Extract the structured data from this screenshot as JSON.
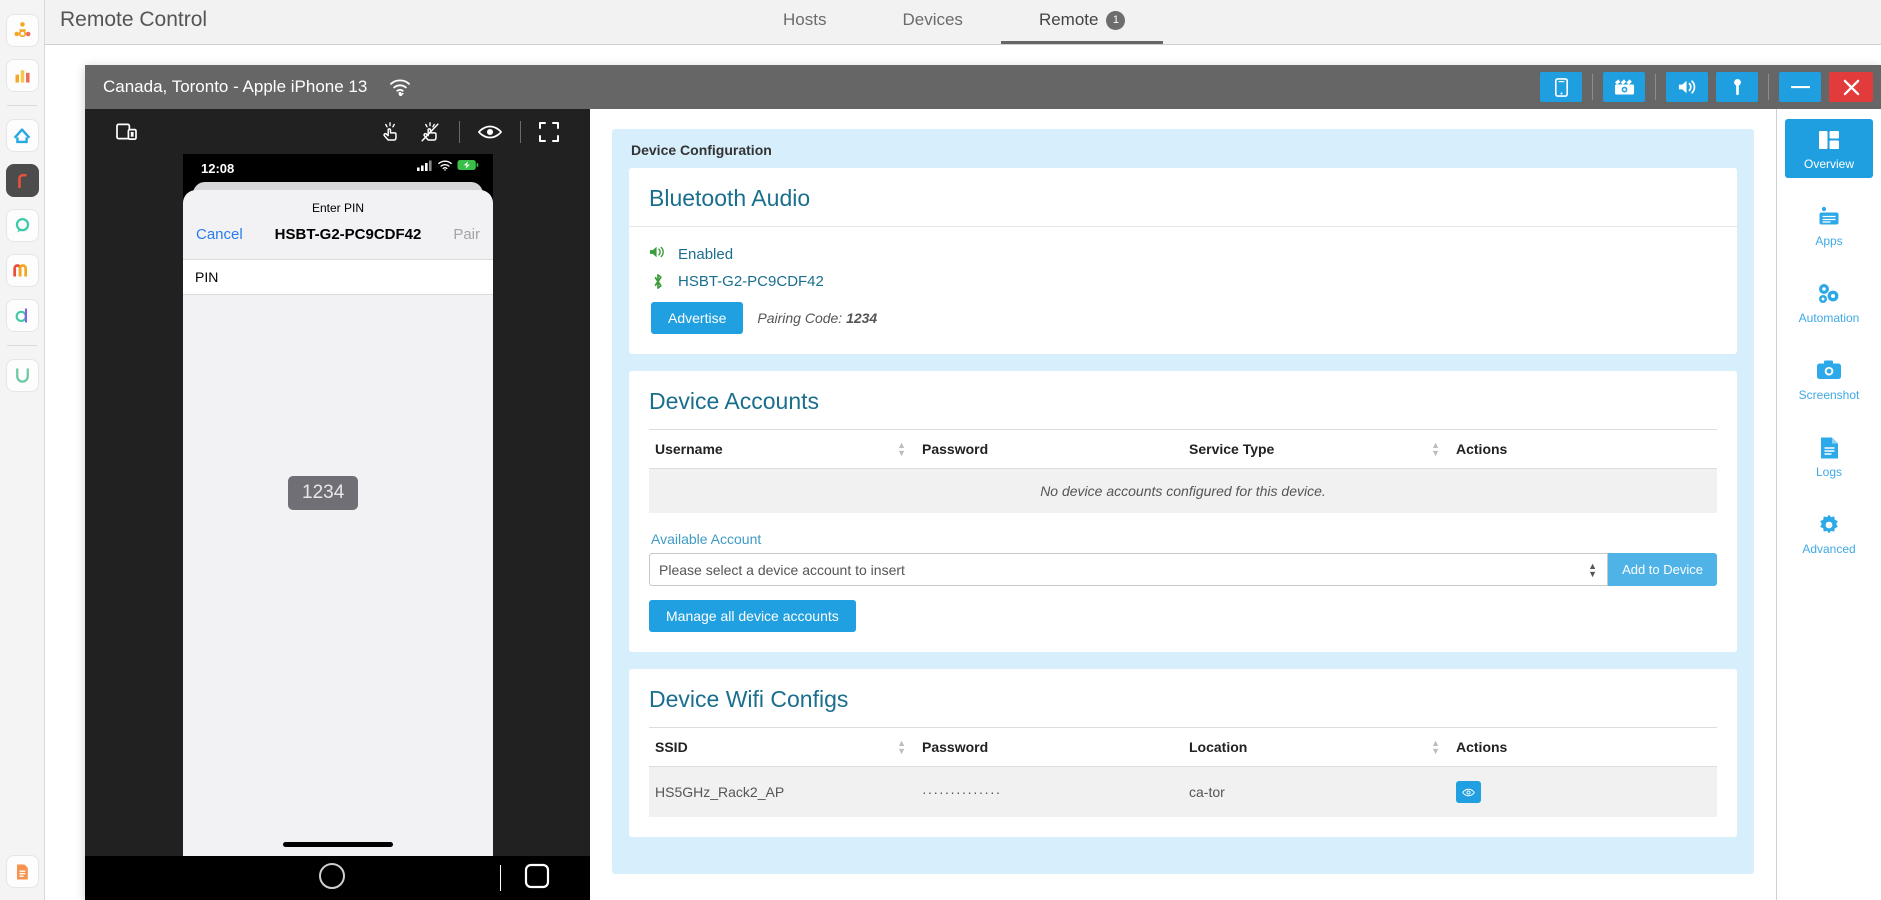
{
  "app_rail": {
    "items": [
      {
        "name": "team-app-icon",
        "glyph": "⚙"
      },
      {
        "name": "analytics-app-icon",
        "glyph": "ὌA"
      },
      {
        "name": "home-app-icon",
        "glyph": "⌂"
      },
      {
        "name": "r-app-icon",
        "glyph": "r"
      },
      {
        "name": "p-app-icon",
        "glyph": "p"
      },
      {
        "name": "m-app-icon",
        "glyph": "m"
      },
      {
        "name": "d-app-icon",
        "glyph": "d"
      },
      {
        "name": "u-app-icon",
        "glyph": "U"
      },
      {
        "name": "document-app-icon",
        "glyph": "☰"
      }
    ]
  },
  "topbar": {
    "title": "Remote Control",
    "tabs": [
      {
        "label": "Hosts",
        "active": false,
        "badge": ""
      },
      {
        "label": "Devices",
        "active": false,
        "badge": ""
      },
      {
        "label": "Remote",
        "active": true,
        "badge": "1"
      }
    ]
  },
  "window": {
    "device_name": "Canada, Toronto - Apple iPhone 13",
    "wifi_icon": "wifi-check-icon",
    "title_buttons": [
      {
        "name": "phone-view-button",
        "icon": "phone-icon"
      },
      {
        "name": "video-record-button",
        "icon": "clapperboard-camera-icon"
      },
      {
        "name": "speaker-button",
        "icon": "speaker-icon"
      },
      {
        "name": "microphone-button",
        "icon": "microphone-icon"
      },
      {
        "name": "minimize-button",
        "icon": "minus-icon"
      },
      {
        "name": "close-button",
        "icon": "close-x-icon"
      }
    ]
  },
  "phone_toolbar": {
    "buttons": [
      {
        "name": "device-screen-toggle-icon",
        "icon": "device-screen-icon"
      },
      {
        "name": "touch-enable-icon",
        "icon": "tap-hand-icon"
      },
      {
        "name": "touch-disable-icon",
        "icon": "tap-hand-disabled-icon"
      },
      {
        "name": "watch-mode-icon",
        "icon": "eye-icon"
      },
      {
        "name": "fullscreen-icon",
        "icon": "expand-icon"
      }
    ]
  },
  "phone": {
    "status_time": "12:08",
    "status_icons": [
      "cellular-signal-icon",
      "wifi-icon",
      "battery-charging-icon"
    ],
    "pin_dialog": {
      "title": "Enter PIN",
      "cancel_label": "Cancel",
      "device_name": "HSBT-G2-PC9CDF42",
      "pair_label": "Pair",
      "pin_field_label": "PIN",
      "tooltip_value": "1234"
    },
    "nav": {
      "home_button": "home-circle-icon",
      "recents_button": "square-icon"
    }
  },
  "config": {
    "legend": "Device Configuration",
    "bluetooth": {
      "title": "Bluetooth Audio",
      "status_label": "Enabled",
      "device_name": "HSBT-G2-PC9CDF42",
      "advertise_label": "Advertise",
      "pairing_code_label": "Pairing Code:",
      "pairing_code_value": "1234"
    },
    "device_accounts": {
      "title": "Device Accounts",
      "columns": [
        "Username",
        "Password",
        "Service Type",
        "Actions"
      ],
      "empty_message": "No device accounts configured for this device.",
      "available_account_label": "Available Account",
      "select_value": "Please select a device account to insert",
      "add_button": "Add to Device",
      "manage_button": "Manage all device accounts"
    },
    "wifi_configs": {
      "title": "Device Wifi Configs",
      "columns": [
        "SSID",
        "Password",
        "Location",
        "Actions"
      ],
      "rows": [
        {
          "ssid": "HS5GHz_Rack2_AP",
          "password": "··············",
          "location": "ca-tor",
          "action": "reveal-password-button"
        }
      ]
    }
  },
  "right_menu": {
    "items": [
      {
        "label": "Overview",
        "icon": "dashboard-icon",
        "active": true
      },
      {
        "label": "Apps",
        "icon": "apps-card-icon",
        "active": false
      },
      {
        "label": "Automation",
        "icon": "gears-icon",
        "active": false
      },
      {
        "label": "Screenshot",
        "icon": "camera-icon",
        "active": false
      },
      {
        "label": "Logs",
        "icon": "document-lines-icon",
        "active": false
      },
      {
        "label": "Advanced",
        "icon": "gear-icon",
        "active": false
      }
    ]
  },
  "colors": {
    "accent_blue": "#20a0e0",
    "panel_blue": "#d7effc",
    "heading_teal": "#1a6e8e",
    "danger_red": "#e23b3b",
    "status_green": "#3a9c3a"
  }
}
